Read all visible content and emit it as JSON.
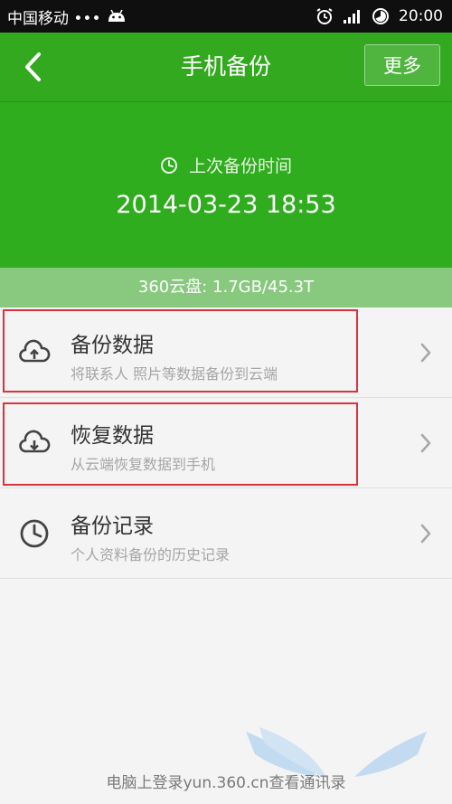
{
  "status_bar": {
    "carrier": "中国移动 •••",
    "time": "20:00",
    "icons": [
      "android-icon",
      "alarm-icon",
      "signal-icon",
      "battery-icon"
    ]
  },
  "header": {
    "title": "手机备份",
    "more_label": "更多"
  },
  "hero": {
    "label": "上次备份时间",
    "time": "2014-03-23 18:53"
  },
  "storage": "360云盘: 1.7GB/45.3T",
  "menu": [
    {
      "title": "备份数据",
      "desc": "将联系人 照片等数据备份到云端",
      "icon": "cloud-upload-icon"
    },
    {
      "title": "恢复数据",
      "desc": "从云端恢复数据到手机",
      "icon": "cloud-download-icon"
    },
    {
      "title": "备份记录",
      "desc": "个人资料备份的历史记录",
      "icon": "clock-icon"
    }
  ],
  "footer": "电脑上登录yun.360.cn查看通讯录",
  "colors": {
    "header_green": "#33a91f",
    "hero_green": "#2fad1e",
    "storage_green": "#89c97f",
    "highlight_red": "#d9343c"
  }
}
